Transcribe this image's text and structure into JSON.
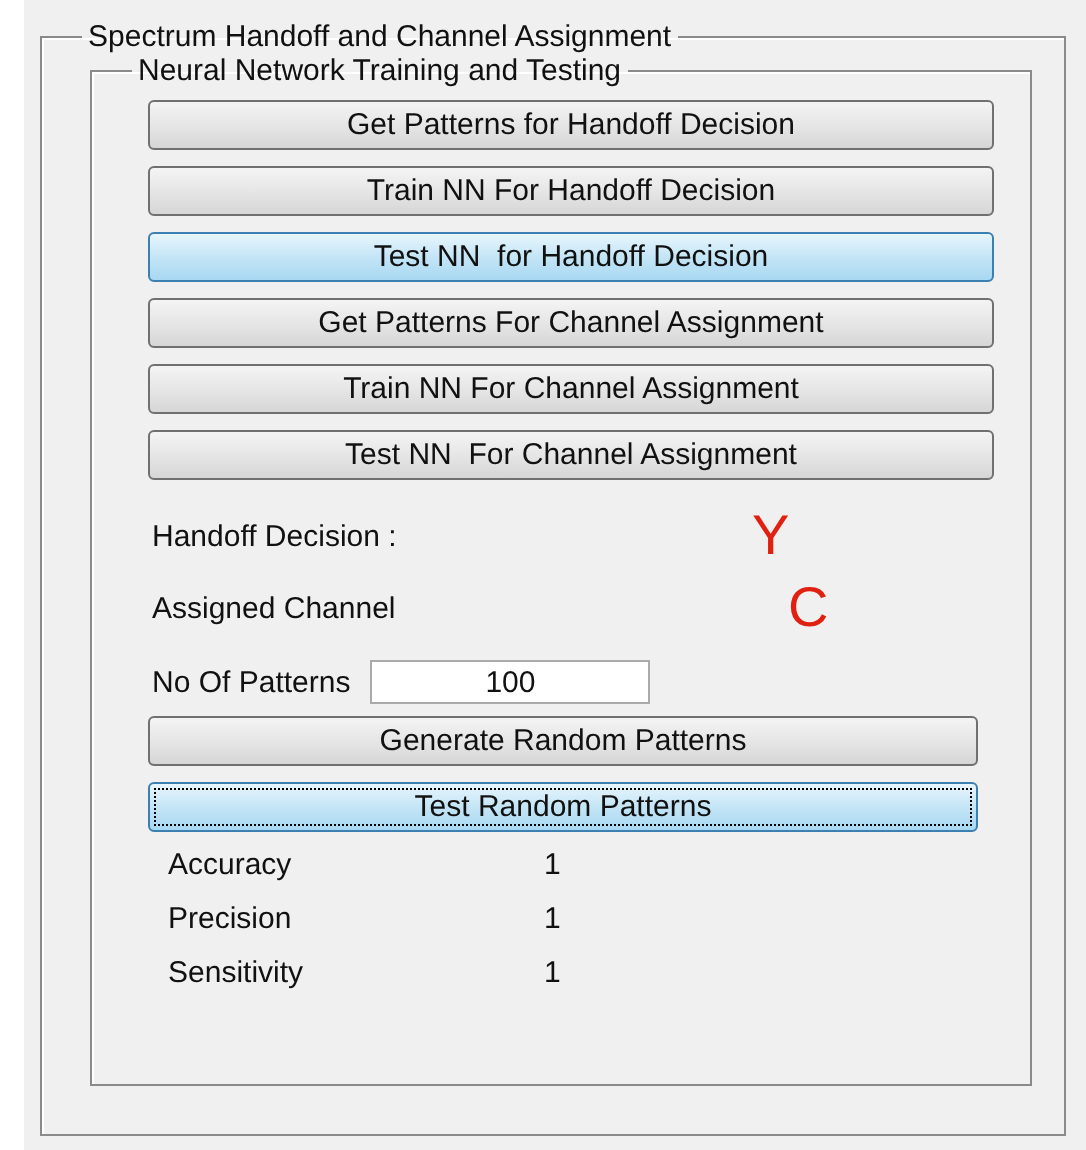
{
  "outer_panel": {
    "title": "Spectrum Handoff and Channel Assignment"
  },
  "inner_panel": {
    "title": "Neural Network Training and Testing",
    "buttons": [
      {
        "label": "Get Patterns for Handoff Decision",
        "highlighted": false,
        "focused": false
      },
      {
        "label": "Train NN For Handoff Decision",
        "highlighted": false,
        "focused": false
      },
      {
        "label": "Test NN  for Handoff Decision",
        "highlighted": true,
        "focused": false
      },
      {
        "label": "Get Patterns For Channel Assignment",
        "highlighted": false,
        "focused": false
      },
      {
        "label": "Train NN For Channel Assignment",
        "highlighted": false,
        "focused": false
      },
      {
        "label": "Test NN  For Channel Assignment",
        "highlighted": false,
        "focused": false
      }
    ],
    "results": [
      {
        "label": "Handoff Decision :",
        "value": "Y"
      },
      {
        "label": "Assigned Channel",
        "value": "C"
      }
    ],
    "patterns_field": {
      "label": "No Of Patterns",
      "value": "100"
    },
    "random_buttons": [
      {
        "label": "Generate Random Patterns",
        "highlighted": false,
        "focused": false
      },
      {
        "label": "Test Random Patterns",
        "highlighted": true,
        "focused": true
      }
    ],
    "metrics": [
      {
        "label": "Accuracy",
        "value": "1"
      },
      {
        "label": "Precision",
        "value": "1"
      },
      {
        "label": "Sensitivity",
        "value": "1"
      }
    ]
  }
}
